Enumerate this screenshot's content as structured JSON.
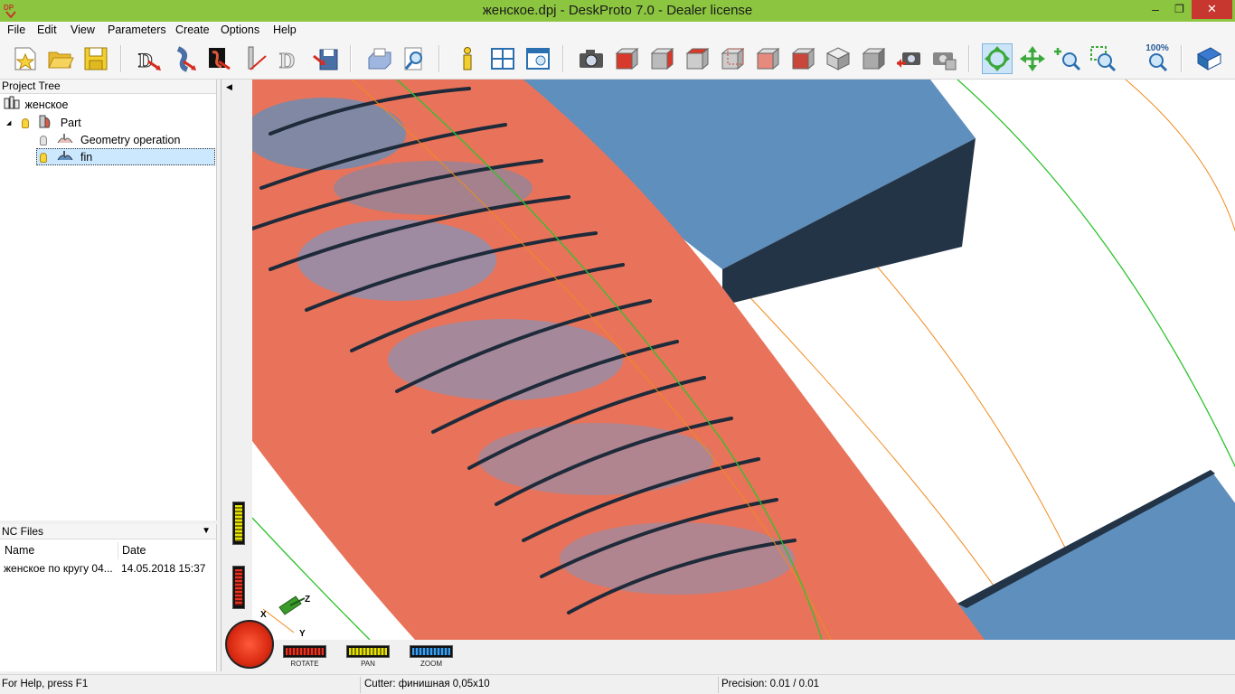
{
  "window": {
    "title": "женское.dpj - DeskProto 7.0 - Dealer license",
    "app_icon": "deskproto-logo-icon",
    "minimize": "–",
    "maximize": "❐",
    "close": "✕"
  },
  "menu": [
    "File",
    "Edit",
    "View",
    "Parameters",
    "Create",
    "Options",
    "Help"
  ],
  "toolbar": {
    "zoom_100_label": "100%",
    "buttons": [
      "new-project-icon",
      "open-project-icon",
      "save-project-icon",
      "geometry-operation-icon",
      "vector-operation-icon",
      "bitmap-operation-icon",
      "cutter-icon",
      "wizard-icon",
      "save-nc-icon",
      "print-icon",
      "print-preview-icon",
      "info-icon",
      "layout-icon",
      "view-settings-icon",
      "camera-icon",
      "view-front-icon",
      "view-right-icon",
      "view-top-icon",
      "view-back-icon",
      "view-left-icon",
      "view-bottom-icon",
      "view-iso-icon",
      "view-grey-icon",
      "camera-restore-icon",
      "camera-save-icon",
      "rotate-mode-icon",
      "pan-mode-icon",
      "zoom-mode-icon",
      "zoom-window-icon",
      "zoom-100-icon",
      "help-book-icon"
    ]
  },
  "project_tree": {
    "header": "Project Tree",
    "items": [
      {
        "label": "женское",
        "level": 0
      },
      {
        "label": "Part",
        "level": 1
      },
      {
        "label": "Geometry operation",
        "level": 2
      },
      {
        "label": "fin",
        "level": 2,
        "selected": true
      }
    ],
    "expander": "◢"
  },
  "nc_files": {
    "header": "NC Files",
    "dropdown": "▼",
    "columns": [
      "Name",
      "Date"
    ],
    "rows": [
      {
        "name": "женское по кругу 04...",
        "date": "14.05.2018 15:37"
      }
    ]
  },
  "viewport": {
    "collapse_arrow": "◀",
    "axes": {
      "x": "X",
      "y": "Y",
      "z": "Z"
    },
    "controls": {
      "rotate": "ROTATE",
      "pan": "PAN",
      "zoom": "ZOOM"
    }
  },
  "statusbar": {
    "help": "For Help, press F1",
    "cutter": "Cutter: финишная 0,05x10",
    "precision": "Precision: 0.01 / 0.01"
  },
  "colors": {
    "title_bar": "#8cc540",
    "close_button": "#c7372f",
    "part_surface": "#e8735a",
    "block_blue": "#5f8fbd",
    "block_dark": "#233447",
    "toolpath_green": "#2ec22e",
    "toolpath_orange": "#f08a1c"
  }
}
